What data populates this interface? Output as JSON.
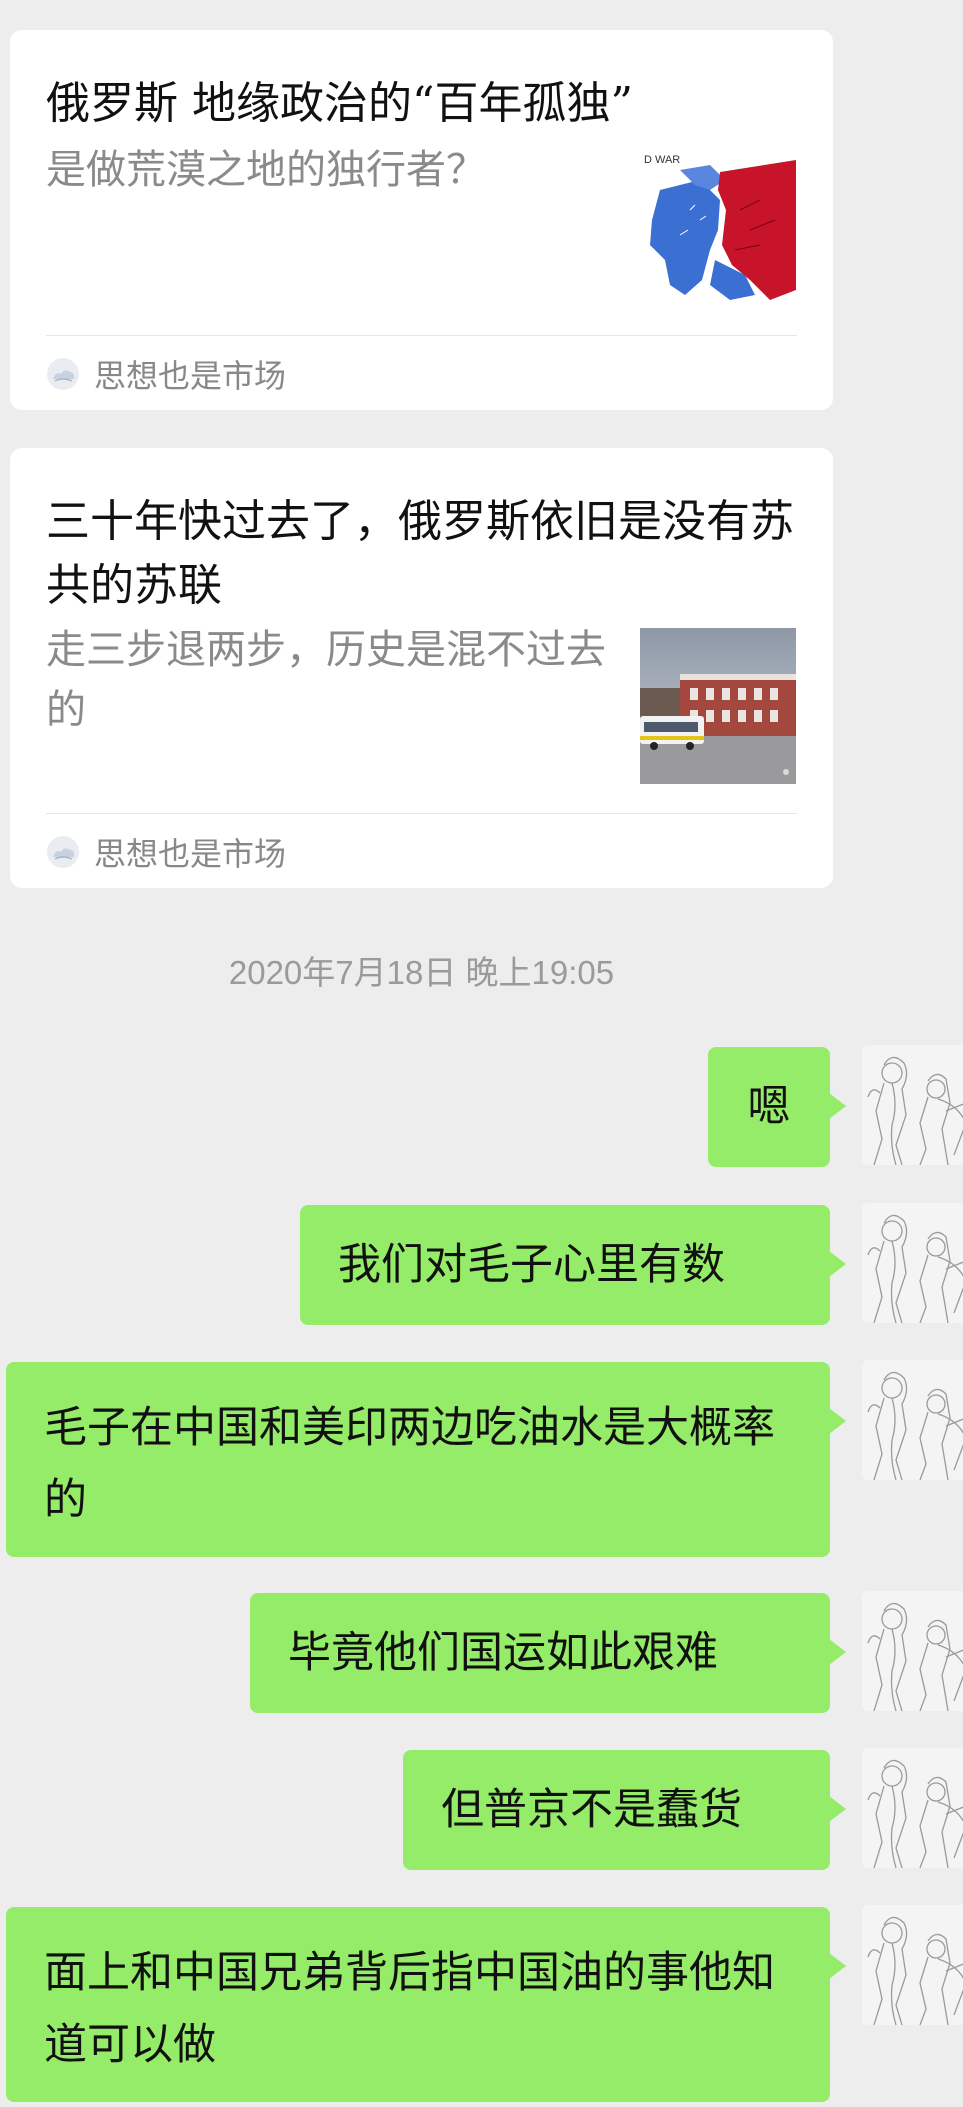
{
  "cards": [
    {
      "title": "俄罗斯 地缘政治的“百年孤独”",
      "description": "是做荒漠之地的独行者？",
      "thumbnail_label": "D WAR",
      "source": "思想也是市场"
    },
    {
      "title": "三十年快过去了，俄罗斯依旧是没有苏共的苏联",
      "description": "走三步退两步，历史是混不过去的",
      "source": "思想也是市场"
    }
  ],
  "timestamp": "2020年7月18日 晚上19:05",
  "messages": [
    {
      "text": "嗯"
    },
    {
      "text": "我们对毛子心里有数"
    },
    {
      "text": "毛子在中国和美印两边吃油水是大概率的"
    },
    {
      "text": "毕竟他们国运如此艰难"
    },
    {
      "text": "但普京不是蠢货"
    },
    {
      "text": "面上和中国兄弟背后指中国油的事他知道可以做"
    }
  ],
  "colors": {
    "background": "#ededed",
    "card": "#ffffff",
    "bubble": "#95ec69",
    "title": "#111111",
    "secondary": "#8a8a8a"
  }
}
